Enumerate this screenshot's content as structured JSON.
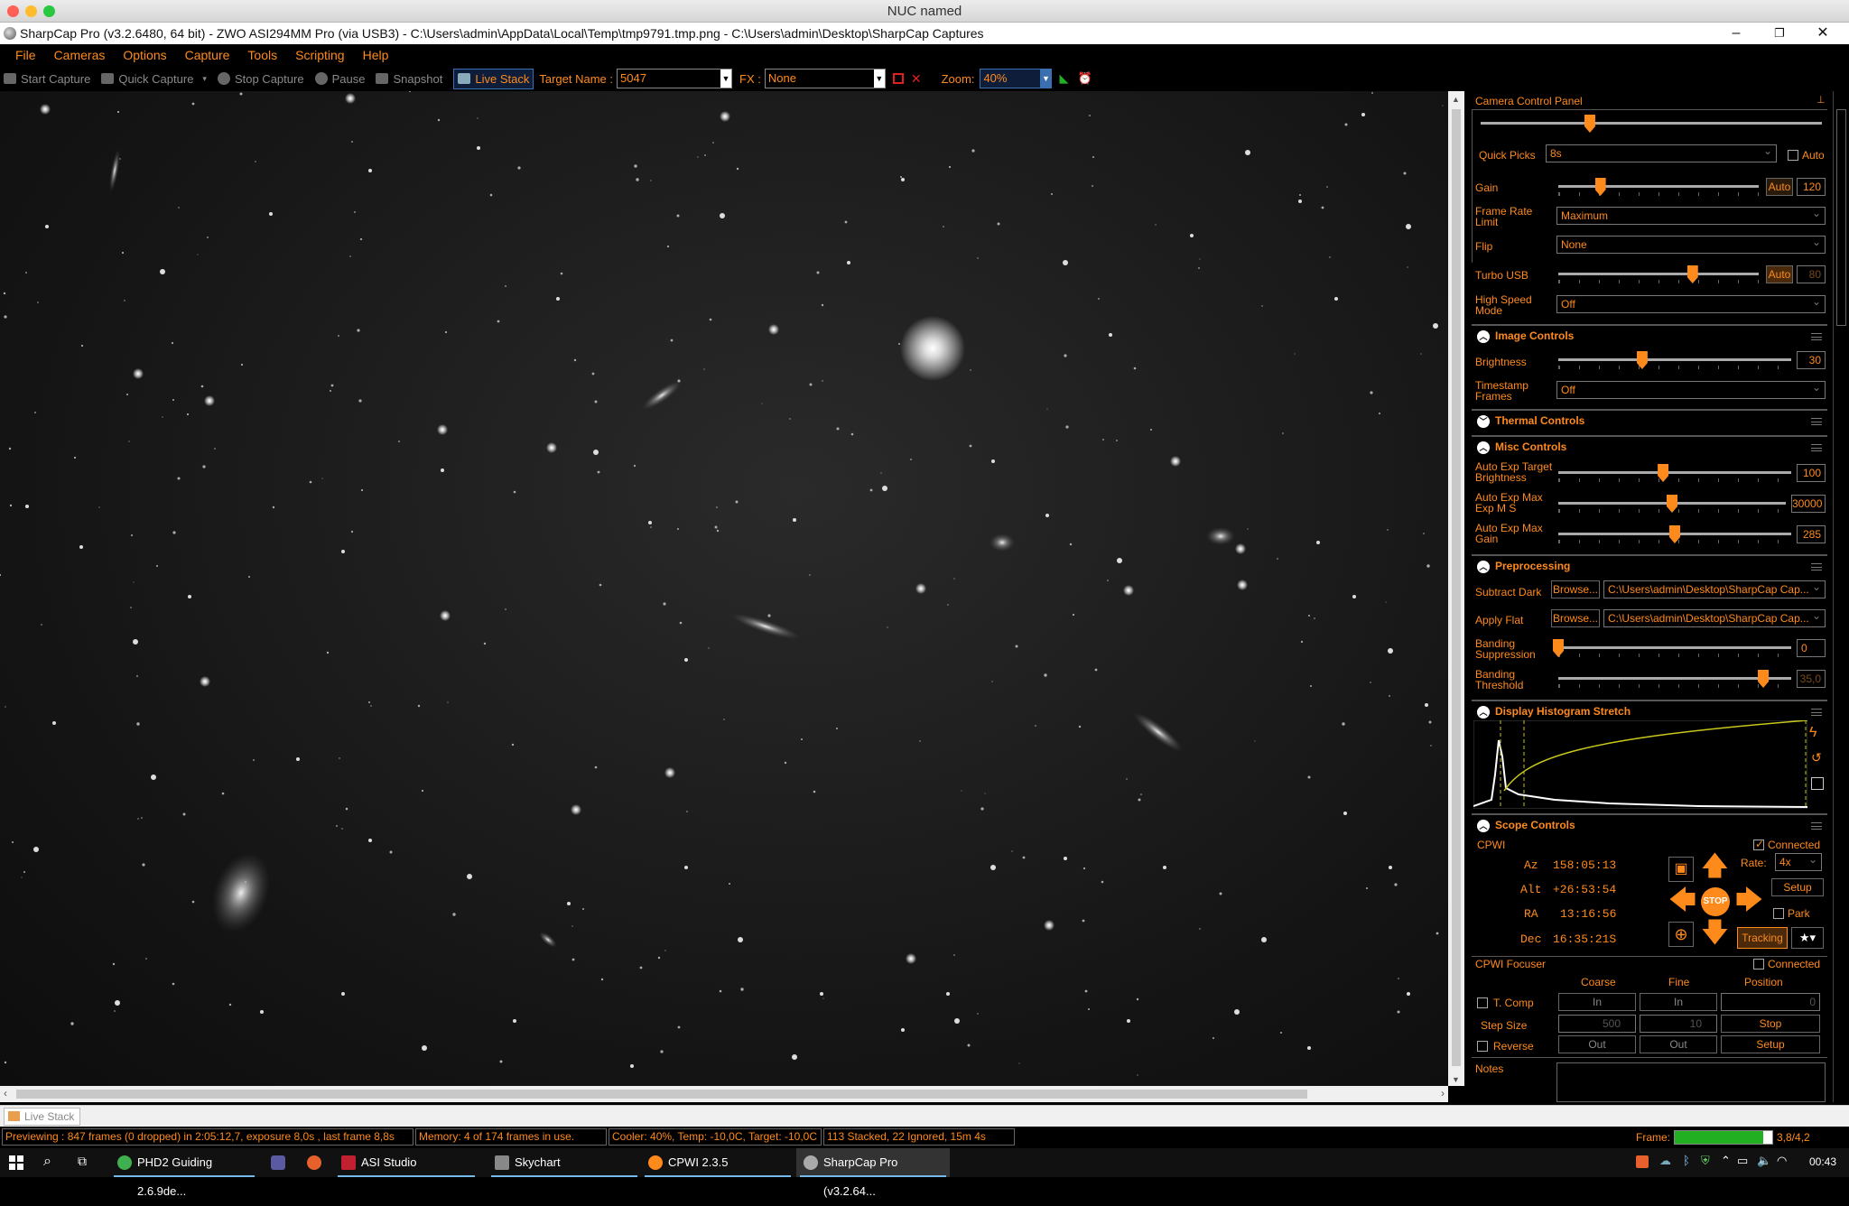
{
  "mac_title": "NUC named",
  "app_title": "SharpCap Pro (v3.2.6480, 64 bit) - ZWO ASI294MM Pro (via USB3) - C:\\Users\\admin\\AppData\\Local\\Temp\\tmp9791.tmp.png - C:\\Users\\admin\\Desktop\\SharpCap Captures",
  "menu": [
    "File",
    "Cameras",
    "Options",
    "Capture",
    "Tools",
    "Scripting",
    "Help"
  ],
  "toolbar": {
    "start_capture": "Start Capture",
    "quick_capture": "Quick Capture",
    "stop_capture": "Stop Capture",
    "pause": "Pause",
    "snapshot": "Snapshot",
    "live_stack": "Live Stack",
    "target_name_label": "Target Name :",
    "target_name_value": "5047",
    "fx_label": "FX :",
    "fx_value": "None",
    "zoom_label": "Zoom:",
    "zoom_value": "40%"
  },
  "panel": {
    "title": "Camera Control Panel",
    "quick_picks_label": "Quick Picks",
    "quick_picks_value": "8s",
    "auto_label": "Auto",
    "gain_label": "Gain",
    "gain_auto": "Auto",
    "gain_value": "120",
    "gain_level": 0.21,
    "exposure_level": 0.32,
    "frame_rate_label": "Frame Rate Limit",
    "frame_rate_value": "Maximum",
    "flip_label": "Flip",
    "flip_value": "None",
    "turbo_label": "Turbo USB",
    "turbo_auto": "Auto",
    "turbo_value": "80",
    "turbo_level": 0.67,
    "hsm_label": "High Speed Mode",
    "hsm_value": "Off",
    "image_controls": "Image Controls",
    "brightness_label": "Brightness",
    "brightness_value": "30",
    "brightness_level": 0.36,
    "timestamp_label": "Timestamp Frames",
    "timestamp_value": "Off",
    "thermal_controls": "Thermal Controls",
    "misc_controls": "Misc Controls",
    "aet_label": "Auto Exp Target Brightness",
    "aet_value": "100",
    "aet_level": 0.45,
    "aem_label": "Auto Exp Max Exp M S",
    "aem_value": "30000",
    "aem_level": 0.5,
    "aeg_label": "Auto Exp Max Gain",
    "aeg_value": "285",
    "aeg_level": 0.5,
    "preprocessing": "Preprocessing",
    "subtract_dark_label": "Subtract Dark",
    "browse": "Browse...",
    "dark_path": "C:\\Users\\admin\\Desktop\\SharpCap Cap...",
    "apply_flat_label": "Apply Flat",
    "flat_path": "C:\\Users\\admin\\Desktop\\SharpCap Cap...",
    "banding_supp_label": "Banding Suppression",
    "banding_supp_value": "0",
    "banding_supp_level": 0.0,
    "banding_thr_label": "Banding Threshold",
    "banding_thr_value": "35,0",
    "banding_thr_level": 0.88,
    "histogram": "Display Histogram Stretch",
    "scope_controls": "Scope Controls",
    "cpwi": "CPWI",
    "connected": "Connected",
    "az_label": "Az",
    "az_value": "158:05:13",
    "alt_label": "Alt",
    "alt_value": "+26:53:54",
    "ra_label": "RA",
    "ra_value": "13:16:56",
    "dec_label": "Dec",
    "dec_value": "16:35:21S",
    "rate_label": "Rate:",
    "rate_value": "4x",
    "setup": "Setup",
    "park": "Park",
    "stop": "STOP",
    "tracking": "Tracking",
    "focuser": "CPWI Focuser",
    "focuser_connected": "Connected",
    "coarse": "Coarse",
    "fine": "Fine",
    "position": "Position",
    "tcomp": "T. Comp",
    "in": "In",
    "position_value": "0",
    "step_size": "Step Size",
    "coarse_step": "500",
    "fine_step": "10",
    "stop_btn": "Stop",
    "reverse": "Reverse",
    "out": "Out",
    "setup2": "Setup",
    "notes": "Notes"
  },
  "tab": "Live Stack",
  "status": {
    "preview": "Previewing : 847 frames (0 dropped) in 2:05:12,7, exposure 8,0s , last frame 8,8s",
    "memory": "Memory: 4 of 174 frames in use.",
    "cooler": "Cooler: 40%, Temp: -10,0C, Target: -10,0C",
    "stacked": "113 Stacked, 22 Ignored, 15m 4s",
    "frame_label": "Frame:",
    "frame_value": "3,8/4,2"
  },
  "taskbar": {
    "items": [
      "PHD2 Guiding 2.6.9de...",
      "ASI Studio",
      "Skychart",
      "CPWI 2.3.5",
      "SharpCap Pro (v3.2.64..."
    ],
    "clock": "00:43"
  },
  "colors": {
    "accent": "#ff8a1c",
    "background": "#000000",
    "frame_progress": "#22b022"
  }
}
